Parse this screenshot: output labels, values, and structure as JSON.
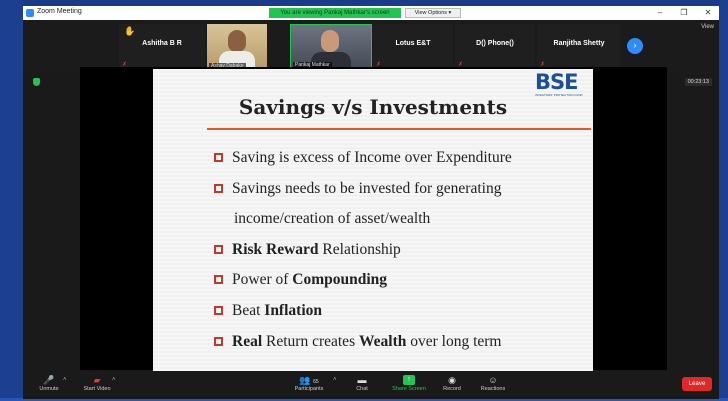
{
  "window": {
    "title": "Zoom Meeting"
  },
  "titlebar": {
    "banner": "You are viewing Pankaj Mathkar's screen",
    "view_options": "View Options ▾",
    "minimize": "–",
    "maximize": "❐",
    "close": "✕"
  },
  "participants": [
    {
      "name": "Ashitha B R"
    },
    {
      "name": "Ashay Dabake"
    },
    {
      "name": "Pankaj Mathkar"
    },
    {
      "name": "Lotus E&T"
    },
    {
      "name": "D() Phone()"
    },
    {
      "name": "Ranjitha Shetty"
    }
  ],
  "view_toggle": "View",
  "timer": "00:23:13",
  "slide": {
    "title": "Savings v/s Investments",
    "logo": "BSE",
    "logo_tagline": "INVESTORS' PROTECTION FUND",
    "bullets": [
      {
        "parts": [
          "Saving is excess of Income over Expenditure"
        ]
      },
      {
        "parts": [
          "Savings needs to be invested for generating"
        ]
      },
      {
        "parts": [
          "income/creation of asset/wealth"
        ]
      },
      {
        "bold1": "Risk Reward",
        "rest": " Relationship"
      },
      {
        "pre": "Power of ",
        "bold1": "Compounding"
      },
      {
        "pre": "Beat ",
        "bold1": "Inflation"
      },
      {
        "bold1": "Real",
        "mid": " Return creates ",
        "bold2": "Wealth",
        "rest": " over long term"
      }
    ]
  },
  "toolbar": {
    "unmute": "Unmute",
    "start_video": "Start Video",
    "participants": "Participants",
    "participants_count": "65",
    "chat": "Chat",
    "share_screen": "Share Screen",
    "record": "Record",
    "reactions": "Reactions",
    "leave": "Leave"
  },
  "colors": {
    "accent": "#2d8cff",
    "share_green": "#23c552",
    "leave_red": "#e02828",
    "slide_bullet": "#c0392b"
  }
}
